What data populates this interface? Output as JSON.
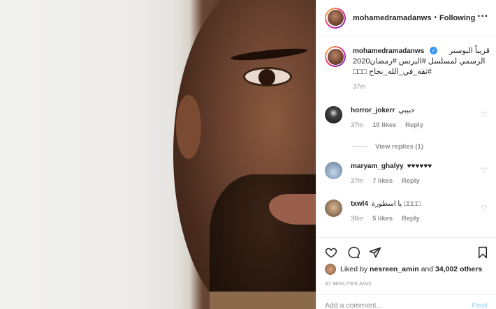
{
  "header": {
    "username": "mohamedramadanws",
    "separator": "•",
    "follow_status": "Following",
    "more_icon": "more-horizontal-icon"
  },
  "caption": {
    "username": "mohamedramadanws",
    "verified_icon": "verified-badge-icon",
    "line1": "قريباً البوستر",
    "line2": "الرسمي لمسلسل #البرنس #رمضان2020",
    "line3": "#ثقة_في_الله_نجاح □□□",
    "time": "37m"
  },
  "comments": [
    {
      "username": "horror_jokerr",
      "text": "حبيبي",
      "time": "37m",
      "likes": "10 likes",
      "reply": "Reply",
      "avatar_color": "#1f1f1f"
    },
    {
      "username": "maryam_ghalyy",
      "text": "♥♥♥♥♥♥",
      "time": "37m",
      "likes": "7 likes",
      "reply": "Reply",
      "avatar_color": "#8aa4c0"
    },
    {
      "username": "txwl4",
      "text": "يا اسطورة □□□□",
      "time": "36m",
      "likes": "5 likes",
      "reply": "Reply",
      "avatar_color": "#7a6a5a"
    }
  ],
  "view_replies": "View replies (1)",
  "likes": {
    "prefix": "Liked by",
    "user": "nesreen_amin",
    "middle": "and",
    "count": "34,002 others"
  },
  "posted_ago": "37 MINUTES AGO",
  "add_comment_placeholder": "Add a comment...",
  "post_label": "Post",
  "colors": {
    "accent": "#3897f0",
    "muted": "#8e8e8e",
    "text": "#262626",
    "post_disabled": "#b2dffc"
  }
}
